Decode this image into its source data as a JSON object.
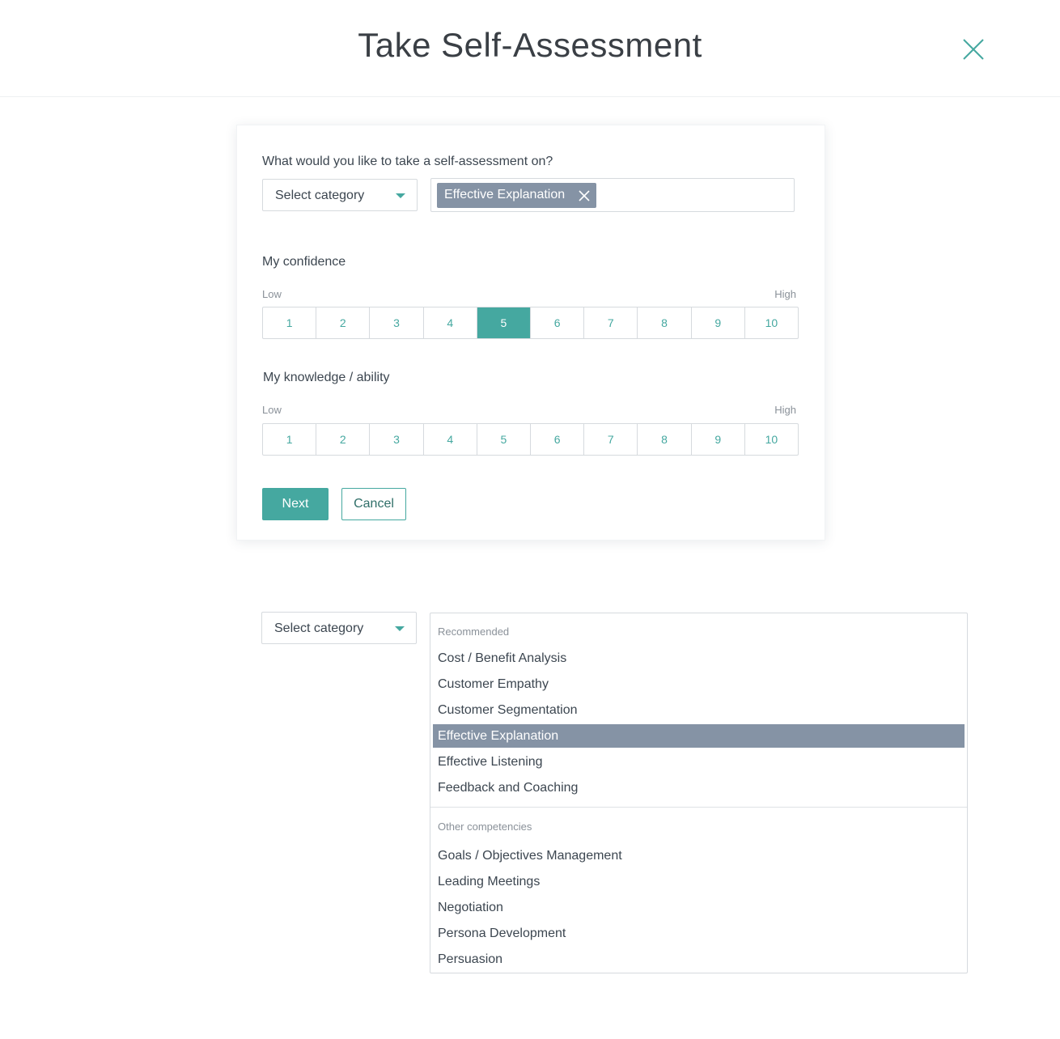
{
  "header": {
    "title": "Take Self-Assessment",
    "close_icon": "close-icon"
  },
  "form": {
    "question": "What would you like to take a self-assessment on?",
    "category_select": {
      "label": "Select category",
      "icon": "caret-down-icon"
    },
    "selected_tag": {
      "label": "Effective Explanation",
      "remove_icon": "close-icon"
    },
    "confidence": {
      "label": "My confidence",
      "low": "Low",
      "high": "High",
      "options": [
        "1",
        "2",
        "3",
        "4",
        "5",
        "6",
        "7",
        "8",
        "9",
        "10"
      ],
      "selected": "5"
    },
    "knowledge": {
      "label": "My knowledge / ability",
      "low": "Low",
      "high": "High",
      "options": [
        "1",
        "2",
        "3",
        "4",
        "5",
        "6",
        "7",
        "8",
        "9",
        "10"
      ],
      "selected": null
    },
    "next_label": "Next",
    "cancel_label": "Cancel"
  },
  "dropdown_demo": {
    "category_select": {
      "label": "Select category",
      "icon": "caret-down-icon"
    },
    "recommended_label": "Recommended",
    "recommended": [
      "Cost / Benefit Analysis",
      "Customer Empathy",
      "Customer Segmentation",
      "Effective Explanation",
      "Effective Listening",
      "Feedback and Coaching"
    ],
    "highlighted": "Effective Explanation",
    "other_label": "Other competencies",
    "other": [
      "Goals / Objectives Management",
      "Leading Meetings",
      "Negotiation",
      "Persona Development",
      "Persuasion"
    ]
  },
  "colors": {
    "accent": "#45a8a0",
    "tag_bg": "#8593a5",
    "border": "#d6dade",
    "text": "#3c4650",
    "muted": "#8a9199"
  }
}
